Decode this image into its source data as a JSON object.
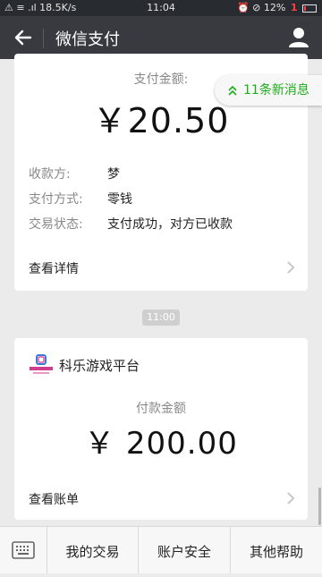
{
  "status_bar": {
    "left": "⚠ ≡ .ıl 18.5K/s",
    "time": "11:04",
    "battery": "⏰ ⊘ 12%",
    "alert": "1"
  },
  "header": {
    "title": "微信支付"
  },
  "payment_card": {
    "amount_label": "支付金额:",
    "amount": "￥20.50",
    "rows": [
      {
        "key": "收款方:",
        "value": "梦"
      },
      {
        "key": "支付方式:",
        "value": "零钱"
      },
      {
        "key": "交易状态:",
        "value": "支付成功，对方已收款"
      }
    ],
    "detail_link": "查看详情"
  },
  "new_messages": "11条新消息",
  "timestamp": "11:00",
  "merchant_card": {
    "merchant": "科乐游戏平台",
    "amount_label": "付款金额",
    "amount": "￥ 200.00",
    "bill_link": "查看账单"
  },
  "bottom_menu": {
    "items": [
      "我的交易",
      "账户安全",
      "其他帮助"
    ]
  },
  "colors": {
    "header_bg": "#393a3f",
    "accent_green": "#1aad19",
    "background": "#ebebeb"
  }
}
